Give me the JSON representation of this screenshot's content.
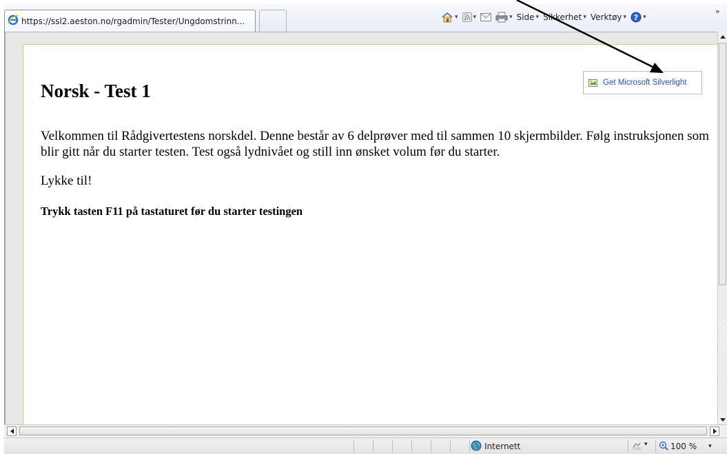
{
  "browser": {
    "tab": {
      "url": "https://ssl2.aeston.no/rgadmin/Tester/Ungdomstrinn..."
    },
    "command_bar": {
      "home_icon": "home-icon",
      "feeds_icon": "feeds-icon",
      "mail_icon": "mail-icon",
      "print_icon": "print-icon",
      "page_label": "Side",
      "safety_label": "Sikkerhet",
      "tools_label": "Verktøy",
      "help_icon": "help-icon",
      "more_chevron": "»"
    }
  },
  "page": {
    "title": "Norsk - Test 1",
    "intro": "Velkommen til Rådgivertestens norskdel. Denne består av 6 delprøver med til sammen 10 skjermbilder. Følg instruksjonen som blir gitt når du starter testen. Test også lydnivået og still inn ønsket volum før du starter.",
    "good_luck": "Lykke til!",
    "instruction": "Trykk tasten F11 på tastaturet før du starter testingen",
    "silverlight_button": "Get Microsoft Silverlight"
  },
  "status_bar": {
    "zone": "Internett",
    "zoom": "100 %"
  },
  "colors": {
    "link": "#2a4fc4",
    "page_border": "#cfcc6a",
    "annotation_arrow": "#000000"
  }
}
